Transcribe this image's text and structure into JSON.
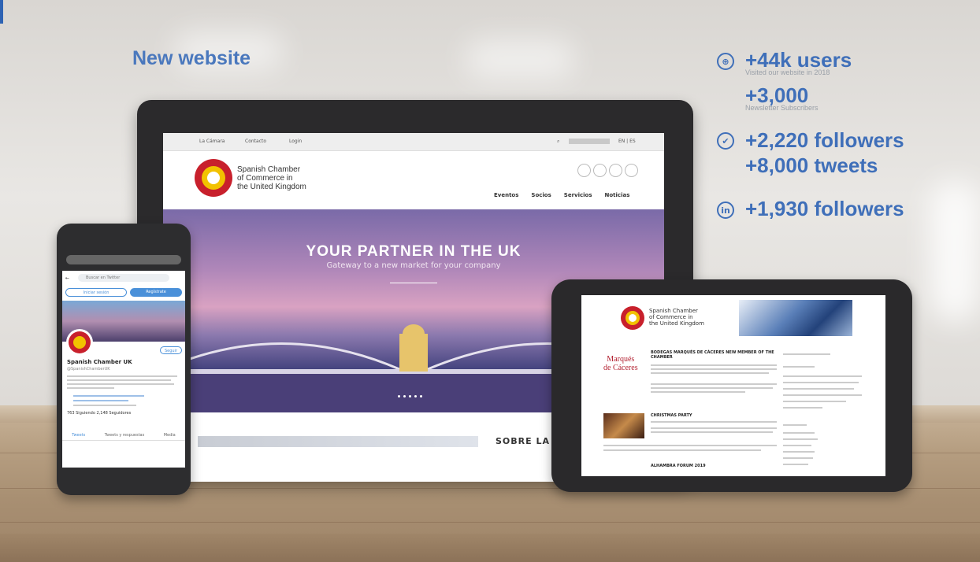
{
  "headline": "New website",
  "stats": [
    {
      "icon": "web-icon",
      "big": "+44k users",
      "small": "Visited our website in 2018"
    },
    {
      "icon": "",
      "big": "+3,000",
      "small": "Newsletter Subscribers"
    },
    {
      "icon": "twitter-icon",
      "big": "+2,220 followers",
      "small": ""
    },
    {
      "icon": "",
      "big": "+8,000 tweets",
      "small": ""
    },
    {
      "icon": "linkedin-icon",
      "big": "+1,930 followers",
      "small": ""
    }
  ],
  "desktop": {
    "topbar": [
      "La Cámara",
      "Contacto",
      "Login"
    ],
    "lang": "EN | ES",
    "org_name": [
      "Spanish Chamber",
      "of Commerce in",
      "the United Kingdom"
    ],
    "nav": [
      "Eventos",
      "Socios",
      "Servicios",
      "Noticias"
    ],
    "hero_title": "YOUR PARTNER IN THE UK",
    "hero_sub": "Gateway to a new market for your company",
    "section_title": "SOBRE LA"
  },
  "phone": {
    "search": "Buscar en Twitter",
    "btn_login": "Iniciar sesión",
    "btn_register": "Regístrate",
    "follow": "Seguir",
    "account": "Spanish Chamber UK",
    "handle": "@SpanishChamberUK",
    "stats": "763 Siguiendo   2,148 Seguidores",
    "tabs": [
      "Tweets",
      "Tweets y respuestas",
      "Media"
    ]
  },
  "tablet": {
    "org_name": [
      "Spanish Chamber",
      "of Commerce in",
      "the United Kingdom"
    ],
    "brand": [
      "Marqués",
      "de Cáceres"
    ],
    "article1": "BODEGAS MARQUÉS DE CÁCERES NEW MEMBER OF THE CHAMBER",
    "article2": "CHRISTMAS PARTY",
    "article3": "ALHAMBRA FORUM 2019"
  },
  "colors": {
    "accent": "#3f6fb9",
    "ring_red": "#c8202c",
    "ring_yellow": "#f2c200"
  }
}
